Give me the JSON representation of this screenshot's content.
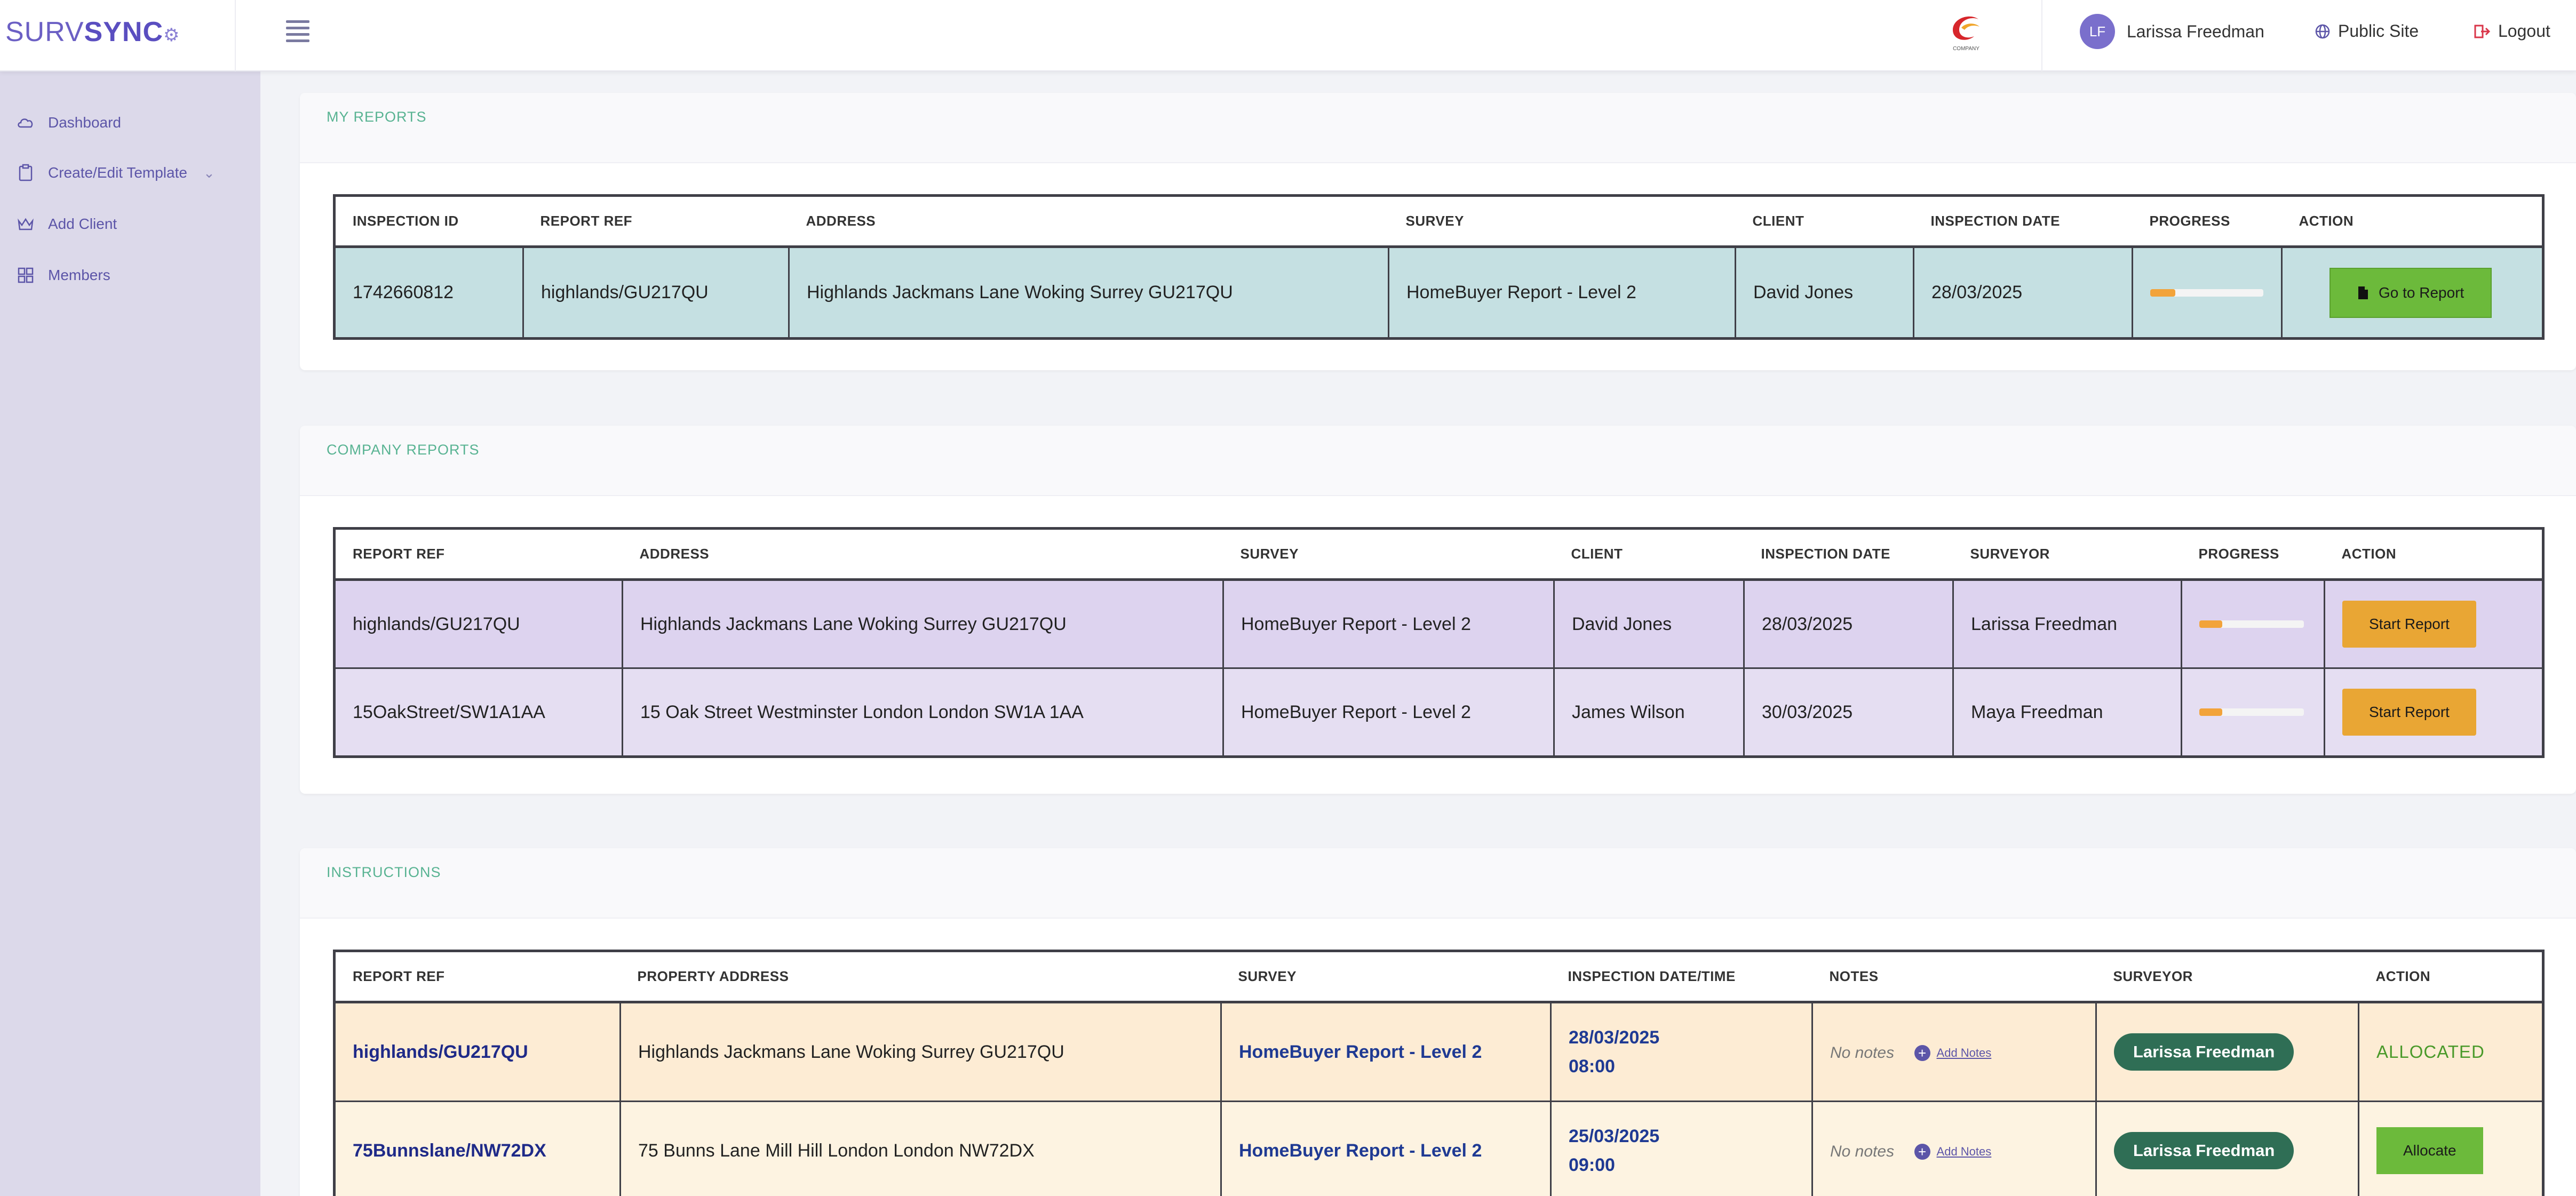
{
  "header": {
    "logo_text_light": "SURV",
    "logo_text_bold": "SYNC",
    "user_initials": "LF",
    "user_name": "Larissa Freedman",
    "public_site": "Public Site",
    "logout": "Logout",
    "company_logo_caption": "COMPANY"
  },
  "sidebar": {
    "items": [
      {
        "label": "Dashboard",
        "icon": "cloud-icon"
      },
      {
        "label": "Create/Edit Template",
        "icon": "clipboard-icon"
      },
      {
        "label": "Add Client",
        "icon": "crown-icon"
      },
      {
        "label": "Members",
        "icon": "grid-icon"
      }
    ]
  },
  "my_reports": {
    "title": "MY REPORTS",
    "headers": [
      "INSPECTION ID",
      "REPORT REF",
      "ADDRESS",
      "SURVEY",
      "CLIENT",
      "INSPECTION DATE",
      "PROGRESS",
      "ACTION"
    ],
    "rows": [
      {
        "inspection_id": "1742660812",
        "report_ref": "highlands/GU217QU",
        "address": "Highlands Jackmans Lane Woking Surrey GU217QU",
        "survey": "HomeBuyer Report - Level 2",
        "client": "David Jones",
        "inspection_date": "28/03/2025",
        "progress": 0.22,
        "action": "Go to Report"
      }
    ]
  },
  "company_reports": {
    "title": "COMPANY REPORTS",
    "headers": [
      "REPORT REF",
      "ADDRESS",
      "SURVEY",
      "CLIENT",
      "INSPECTION DATE",
      "SURVEYOR",
      "PROGRESS",
      "ACTION"
    ],
    "rows": [
      {
        "report_ref": "highlands/GU217QU",
        "address": "Highlands Jackmans Lane Woking Surrey GU217QU",
        "survey": "HomeBuyer Report - Level 2",
        "client": "David Jones",
        "inspection_date": "28/03/2025",
        "surveyor": "Larissa Freedman",
        "progress": 0.22,
        "action": "Start Report"
      },
      {
        "report_ref": "15OakStreet/SW1A1AA",
        "address": "15 Oak Street Westminster London London SW1A 1AA",
        "survey": "HomeBuyer Report - Level 2",
        "client": "James Wilson",
        "inspection_date": "30/03/2025",
        "surveyor": "Maya Freedman",
        "progress": 0.22,
        "action": "Start Report"
      }
    ]
  },
  "instructions": {
    "title": "INSTRUCTIONS",
    "headers": [
      "REPORT REF",
      "PROPERTY ADDRESS",
      "SURVEY",
      "INSPECTION DATE/TIME",
      "NOTES",
      "SURVEYOR",
      "ACTION"
    ],
    "rows": [
      {
        "report_ref": "highlands/GU217QU",
        "address": "Highlands Jackmans Lane Woking Surrey GU217QU",
        "survey": "HomeBuyer Report - Level 2",
        "date": "28/03/2025",
        "time": "08:00",
        "notes": "No notes",
        "add_notes": "Add Notes",
        "surveyor": "Larissa Freedman",
        "action": "ALLOCATED"
      },
      {
        "report_ref": "75Bunnslane/NW72DX",
        "address": "75 Bunns Lane Mill Hill London London NW72DX",
        "survey": "HomeBuyer Report - Level 2",
        "date": "25/03/2025",
        "time": "09:00",
        "notes": "No notes",
        "add_notes": "Add Notes",
        "surveyor": "Larissa Freedman",
        "action": "Allocate"
      }
    ]
  },
  "colors": {
    "brand": "#6b5fc4",
    "section_title": "#58b392",
    "progress_fill": "#f2a33a",
    "go_button": "#6cba3b",
    "start_button": "#e9a634",
    "surveyor_pill": "#2f6e55"
  }
}
